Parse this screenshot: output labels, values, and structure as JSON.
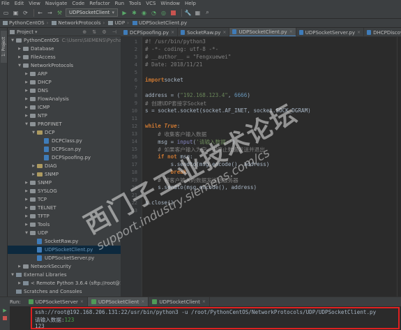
{
  "menu": [
    "File",
    "Edit",
    "View",
    "Navigate",
    "Code",
    "Refactor",
    "Run",
    "Tools",
    "VCS",
    "Window",
    "Help"
  ],
  "toolbar": {
    "run_config": "UDPSocketClient"
  },
  "breadcrumb": [
    "PythonCentOS",
    "NetworkProtocols",
    "UDP",
    "UDPSocketClient.py"
  ],
  "project_panel": {
    "title": "Project",
    "tree": [
      {
        "label": "PythonCentOS",
        "sub": "C:\\Users\\SIEMENS\\PycharmP",
        "depth": 0,
        "arrow": "▼",
        "icon": "folder"
      },
      {
        "label": "Database",
        "depth": 1,
        "arrow": "▶",
        "icon": "folder"
      },
      {
        "label": "FileAccess",
        "depth": 1,
        "arrow": "▶",
        "icon": "folder"
      },
      {
        "label": "NetworkProtocols",
        "depth": 1,
        "arrow": "▼",
        "icon": "folder"
      },
      {
        "label": "ARP",
        "depth": 2,
        "arrow": "▶",
        "icon": "folder"
      },
      {
        "label": "DHCP",
        "depth": 2,
        "arrow": "▶",
        "icon": "folder"
      },
      {
        "label": "DNS",
        "depth": 2,
        "arrow": "▶",
        "icon": "folder"
      },
      {
        "label": "FlowAnalysis",
        "depth": 2,
        "arrow": "▶",
        "icon": "folder"
      },
      {
        "label": "ICMP",
        "depth": 2,
        "arrow": "▶",
        "icon": "folder"
      },
      {
        "label": "NTP",
        "depth": 2,
        "arrow": "▶",
        "icon": "folder"
      },
      {
        "label": "PROFINET",
        "depth": 2,
        "arrow": "▼",
        "icon": "folder"
      },
      {
        "label": "DCP",
        "depth": 3,
        "arrow": "▼",
        "icon": "pkg"
      },
      {
        "label": "DCPClass.py",
        "depth": 4,
        "arrow": "",
        "icon": "py"
      },
      {
        "label": "DCPScan.py",
        "depth": 4,
        "arrow": "",
        "icon": "py"
      },
      {
        "label": "DCPSpoofing.py",
        "depth": 4,
        "arrow": "",
        "icon": "py"
      },
      {
        "label": "DIAG",
        "depth": 3,
        "arrow": "▶",
        "icon": "pkg"
      },
      {
        "label": "SNMP",
        "depth": 3,
        "arrow": "▶",
        "icon": "pkg"
      },
      {
        "label": "SNMP",
        "depth": 2,
        "arrow": "▶",
        "icon": "folder"
      },
      {
        "label": "SYSLOG",
        "depth": 2,
        "arrow": "▶",
        "icon": "folder"
      },
      {
        "label": "TCP",
        "depth": 2,
        "arrow": "▶",
        "icon": "folder"
      },
      {
        "label": "TELNET",
        "depth": 2,
        "arrow": "▶",
        "icon": "folder"
      },
      {
        "label": "TFTP",
        "depth": 2,
        "arrow": "▶",
        "icon": "folder"
      },
      {
        "label": "Tools",
        "depth": 2,
        "arrow": "▶",
        "icon": "folder"
      },
      {
        "label": "UDP",
        "depth": 2,
        "arrow": "▼",
        "icon": "folder"
      },
      {
        "label": "SocketRaw.py",
        "depth": 3,
        "arrow": "",
        "icon": "py"
      },
      {
        "label": "UDPSocketClient.py",
        "depth": 3,
        "arrow": "",
        "icon": "py",
        "selected": true
      },
      {
        "label": "UDPSocketServer.py",
        "depth": 3,
        "arrow": "",
        "icon": "py"
      },
      {
        "label": "NetworkSecurity",
        "depth": 1,
        "arrow": "▶",
        "icon": "folder"
      },
      {
        "label": "External Libraries",
        "depth": 0,
        "arrow": "▼",
        "icon": "lib"
      },
      {
        "label": "< Remote Python 3.6.4 (sftp://root@192.1",
        "depth": 1,
        "arrow": "▶",
        "icon": "lib"
      },
      {
        "label": "Scratches and Consoles",
        "depth": 0,
        "arrow": "",
        "icon": "lib"
      }
    ]
  },
  "editor_tabs": [
    {
      "label": "DCPSpoofing.py",
      "active": false
    },
    {
      "label": "SocketRaw.py",
      "active": false
    },
    {
      "label": "UDPSocketClient.py",
      "active": true
    },
    {
      "label": "UDPSocketServer.py",
      "active": false
    },
    {
      "label": "DHCPDiscover.py",
      "active": false
    }
  ],
  "code_lines": [
    [
      [
        "c-com",
        "#! /usr/bin/python3"
      ]
    ],
    [
      [
        "c-com",
        "# -*- coding: utf-8 -*-"
      ]
    ],
    [
      [
        "c-com",
        "# __author__ = \"Fengxuewei\""
      ]
    ],
    [
      [
        "c-com",
        "# Date: 2018/11/21"
      ]
    ],
    [],
    [
      [
        "c-kw",
        "import"
      ],
      [
        "",
        "socket"
      ]
    ],
    [],
    [
      [
        "",
        "address = ("
      ],
      [
        "c-str",
        "\"192.168.123.4\""
      ],
      [
        "",
        ", "
      ],
      [
        "c-num",
        "6666"
      ],
      [
        "",
        ")"
      ]
    ],
    [
      [
        "c-com",
        "# 创建UDP套接字Socket"
      ]
    ],
    [
      [
        "",
        "s = socket.socket(socket.AF_INET, socket.SOCK_DGRAM)"
      ]
    ],
    [],
    [
      [
        "c-kw",
        "while "
      ],
      [
        "c-it",
        "True"
      ],
      [
        "",
        ":"
      ]
    ],
    [
      [
        "",
        "    "
      ],
      [
        "c-com",
        "# 收集客户输入数据"
      ]
    ],
    [
      [
        "",
        "    msg = "
      ],
      [
        "c-bi",
        "input"
      ],
      [
        "",
        "("
      ],
      [
        "c-str",
        "'请输入数据:'"
      ],
      [
        "",
        ")"
      ]
    ],
    [
      [
        "",
        "    "
      ],
      [
        "c-com",
        "# 如果客户输入为空，则停止数据发送并退出"
      ]
    ],
    [
      [
        "",
        "    "
      ],
      [
        "c-kw",
        "if not "
      ],
      [
        "",
        "msg:"
      ]
    ],
    [
      [
        "",
        "        s.sendto(msg.encode(), address)"
      ]
    ],
    [
      [
        "",
        "        "
      ],
      [
        "c-kw",
        "break"
      ]
    ],
    [
      [
        "",
        "    "
      ],
      [
        "c-com",
        "# 将客户输入的数据发送给服务器"
      ]
    ],
    [
      [
        "",
        "    s.sendto(msg.encode(), address)"
      ]
    ],
    [],
    [
      [
        "",
        "s.close()"
      ]
    ]
  ],
  "line_numbers": [
    "1",
    "2",
    "3",
    "4",
    "5",
    "6",
    "7",
    "8",
    "9",
    "10",
    "11",
    "12",
    "13",
    "14",
    "15",
    "16",
    "17",
    "18",
    "19",
    "20",
    "21",
    "22",
    "23"
  ],
  "watermark": {
    "line1": "西门子工业技术论坛",
    "line2": "support.industry.siemens.com/cs"
  },
  "run_panel": {
    "label": "Run:",
    "tabs": [
      {
        "label": "UDPSocketServer",
        "active": false
      },
      {
        "label": "UDPSocketClient",
        "active": true
      },
      {
        "label": "UDPSocketClient",
        "active": false
      }
    ],
    "command": "ssh://root@192.168.206.131:22/usr/bin/python3 -u /root/PythonCentOS/NetworkProtocols/UDP/UDPSocketClient.py",
    "prompt": "请输入数据:",
    "prompt_input": "123",
    "output": "123"
  },
  "colors": {
    "selection": "#0d293e",
    "highlight_box": "#e02020",
    "comment": "#808080",
    "keyword": "#cc7832",
    "string": "#6a8759"
  }
}
